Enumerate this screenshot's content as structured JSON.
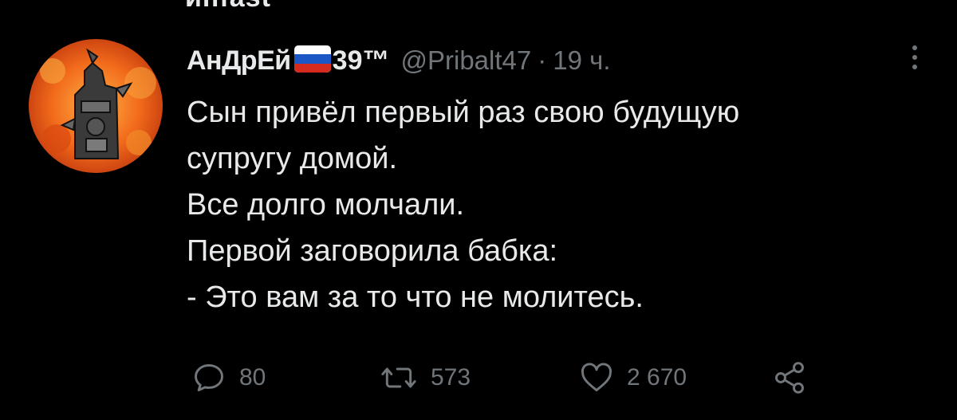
{
  "tweet": {
    "cut_text": "ипfast",
    "author": {
      "display_name": "АнДрЕй",
      "flag_icon": "russian-flag-icon",
      "name_suffix": "39™",
      "handle": "@Pribalt47",
      "separator": "·",
      "time_ago": "19 ч."
    },
    "text_lines": [
      "Сын привёл первый раз свою будущую",
      "супругу домой.",
      "Все долго молчали.",
      "Первой заговорила бабка:",
      "- Это вам за то что не молитесь."
    ],
    "actions": {
      "reply": {
        "icon": "reply-icon",
        "count": "80"
      },
      "retweet": {
        "icon": "retweet-icon",
        "count": "573"
      },
      "like": {
        "icon": "heart-icon",
        "count": "2 670"
      },
      "share": {
        "icon": "share-icon"
      }
    },
    "colors": {
      "background": "#000000",
      "text": "#e7e9ea",
      "secondary": "#71767b",
      "avatar_fire": "#e8500e"
    }
  }
}
